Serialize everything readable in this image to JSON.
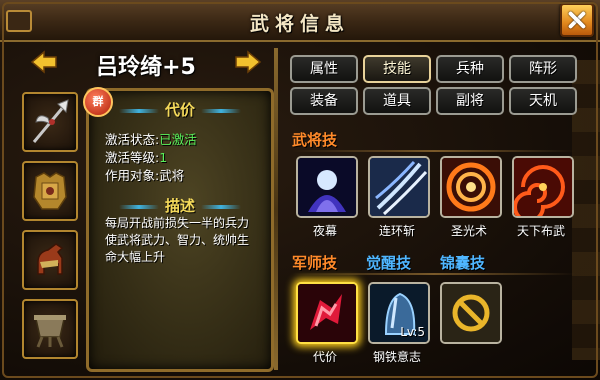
{
  "window": {
    "title": "武将信息"
  },
  "general": {
    "name": "吕玲绮+5"
  },
  "detail": {
    "badge": "群",
    "cost_title": "代价",
    "activation_label": "激活状态:",
    "activation_value": "已激活",
    "level_label": "激活等级:",
    "level_value": "1",
    "target_label": "作用对象:",
    "target_value": "武将",
    "desc_title": "描述",
    "desc_text": "每局开战前损失一半的兵力使武将武力、智力、统帅生命大幅上升"
  },
  "tabs": [
    {
      "label": "属性",
      "active": false
    },
    {
      "label": "技能",
      "active": true
    },
    {
      "label": "兵种",
      "active": false
    },
    {
      "label": "阵形",
      "active": false
    },
    {
      "label": "装备",
      "active": false
    },
    {
      "label": "道具",
      "active": false
    },
    {
      "label": "副将",
      "active": false
    },
    {
      "label": "天机",
      "active": false
    }
  ],
  "sections": {
    "general_skills": "武将技",
    "strategist_skills": "军师技",
    "awaken_skills": "觉醒技",
    "bag_skills": "锦囊技"
  },
  "general_skills": [
    {
      "name": "夜幕",
      "icon": "night-curtain-icon"
    },
    {
      "name": "连环斩",
      "icon": "chain-slash-icon"
    },
    {
      "name": "圣光术",
      "icon": "holy-light-icon"
    },
    {
      "name": "天下布武",
      "icon": "world-martial-icon"
    }
  ],
  "bottom_skills": [
    {
      "name": "代价",
      "icon": "cost-icon",
      "selected": true
    },
    {
      "name": "钢铁意志",
      "icon": "iron-will-icon",
      "level": "Lv:5"
    },
    {
      "name": "",
      "icon": "locked-slot-icon"
    }
  ],
  "colors": {
    "accent": "#ff8a2a",
    "active_green": "#5af05a",
    "section_blue": "#4fb6ff",
    "selection_gold": "#ffe044"
  }
}
